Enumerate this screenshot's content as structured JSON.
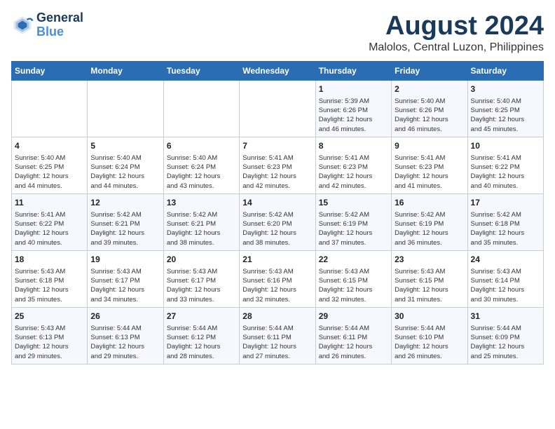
{
  "header": {
    "logo_line1": "General",
    "logo_line2": "Blue",
    "month": "August 2024",
    "location": "Malolos, Central Luzon, Philippines"
  },
  "weekdays": [
    "Sunday",
    "Monday",
    "Tuesday",
    "Wednesday",
    "Thursday",
    "Friday",
    "Saturday"
  ],
  "weeks": [
    [
      {
        "day": "",
        "info": ""
      },
      {
        "day": "",
        "info": ""
      },
      {
        "day": "",
        "info": ""
      },
      {
        "day": "",
        "info": ""
      },
      {
        "day": "1",
        "info": "Sunrise: 5:39 AM\nSunset: 6:26 PM\nDaylight: 12 hours\nand 46 minutes."
      },
      {
        "day": "2",
        "info": "Sunrise: 5:40 AM\nSunset: 6:26 PM\nDaylight: 12 hours\nand 46 minutes."
      },
      {
        "day": "3",
        "info": "Sunrise: 5:40 AM\nSunset: 6:25 PM\nDaylight: 12 hours\nand 45 minutes."
      }
    ],
    [
      {
        "day": "4",
        "info": "Sunrise: 5:40 AM\nSunset: 6:25 PM\nDaylight: 12 hours\nand 44 minutes."
      },
      {
        "day": "5",
        "info": "Sunrise: 5:40 AM\nSunset: 6:24 PM\nDaylight: 12 hours\nand 44 minutes."
      },
      {
        "day": "6",
        "info": "Sunrise: 5:40 AM\nSunset: 6:24 PM\nDaylight: 12 hours\nand 43 minutes."
      },
      {
        "day": "7",
        "info": "Sunrise: 5:41 AM\nSunset: 6:23 PM\nDaylight: 12 hours\nand 42 minutes."
      },
      {
        "day": "8",
        "info": "Sunrise: 5:41 AM\nSunset: 6:23 PM\nDaylight: 12 hours\nand 42 minutes."
      },
      {
        "day": "9",
        "info": "Sunrise: 5:41 AM\nSunset: 6:23 PM\nDaylight: 12 hours\nand 41 minutes."
      },
      {
        "day": "10",
        "info": "Sunrise: 5:41 AM\nSunset: 6:22 PM\nDaylight: 12 hours\nand 40 minutes."
      }
    ],
    [
      {
        "day": "11",
        "info": "Sunrise: 5:41 AM\nSunset: 6:22 PM\nDaylight: 12 hours\nand 40 minutes."
      },
      {
        "day": "12",
        "info": "Sunrise: 5:42 AM\nSunset: 6:21 PM\nDaylight: 12 hours\nand 39 minutes."
      },
      {
        "day": "13",
        "info": "Sunrise: 5:42 AM\nSunset: 6:21 PM\nDaylight: 12 hours\nand 38 minutes."
      },
      {
        "day": "14",
        "info": "Sunrise: 5:42 AM\nSunset: 6:20 PM\nDaylight: 12 hours\nand 38 minutes."
      },
      {
        "day": "15",
        "info": "Sunrise: 5:42 AM\nSunset: 6:19 PM\nDaylight: 12 hours\nand 37 minutes."
      },
      {
        "day": "16",
        "info": "Sunrise: 5:42 AM\nSunset: 6:19 PM\nDaylight: 12 hours\nand 36 minutes."
      },
      {
        "day": "17",
        "info": "Sunrise: 5:42 AM\nSunset: 6:18 PM\nDaylight: 12 hours\nand 35 minutes."
      }
    ],
    [
      {
        "day": "18",
        "info": "Sunrise: 5:43 AM\nSunset: 6:18 PM\nDaylight: 12 hours\nand 35 minutes."
      },
      {
        "day": "19",
        "info": "Sunrise: 5:43 AM\nSunset: 6:17 PM\nDaylight: 12 hours\nand 34 minutes."
      },
      {
        "day": "20",
        "info": "Sunrise: 5:43 AM\nSunset: 6:17 PM\nDaylight: 12 hours\nand 33 minutes."
      },
      {
        "day": "21",
        "info": "Sunrise: 5:43 AM\nSunset: 6:16 PM\nDaylight: 12 hours\nand 32 minutes."
      },
      {
        "day": "22",
        "info": "Sunrise: 5:43 AM\nSunset: 6:15 PM\nDaylight: 12 hours\nand 32 minutes."
      },
      {
        "day": "23",
        "info": "Sunrise: 5:43 AM\nSunset: 6:15 PM\nDaylight: 12 hours\nand 31 minutes."
      },
      {
        "day": "24",
        "info": "Sunrise: 5:43 AM\nSunset: 6:14 PM\nDaylight: 12 hours\nand 30 minutes."
      }
    ],
    [
      {
        "day": "25",
        "info": "Sunrise: 5:43 AM\nSunset: 6:13 PM\nDaylight: 12 hours\nand 29 minutes."
      },
      {
        "day": "26",
        "info": "Sunrise: 5:44 AM\nSunset: 6:13 PM\nDaylight: 12 hours\nand 29 minutes."
      },
      {
        "day": "27",
        "info": "Sunrise: 5:44 AM\nSunset: 6:12 PM\nDaylight: 12 hours\nand 28 minutes."
      },
      {
        "day": "28",
        "info": "Sunrise: 5:44 AM\nSunset: 6:11 PM\nDaylight: 12 hours\nand 27 minutes."
      },
      {
        "day": "29",
        "info": "Sunrise: 5:44 AM\nSunset: 6:11 PM\nDaylight: 12 hours\nand 26 minutes."
      },
      {
        "day": "30",
        "info": "Sunrise: 5:44 AM\nSunset: 6:10 PM\nDaylight: 12 hours\nand 26 minutes."
      },
      {
        "day": "31",
        "info": "Sunrise: 5:44 AM\nSunset: 6:09 PM\nDaylight: 12 hours\nand 25 minutes."
      }
    ]
  ]
}
